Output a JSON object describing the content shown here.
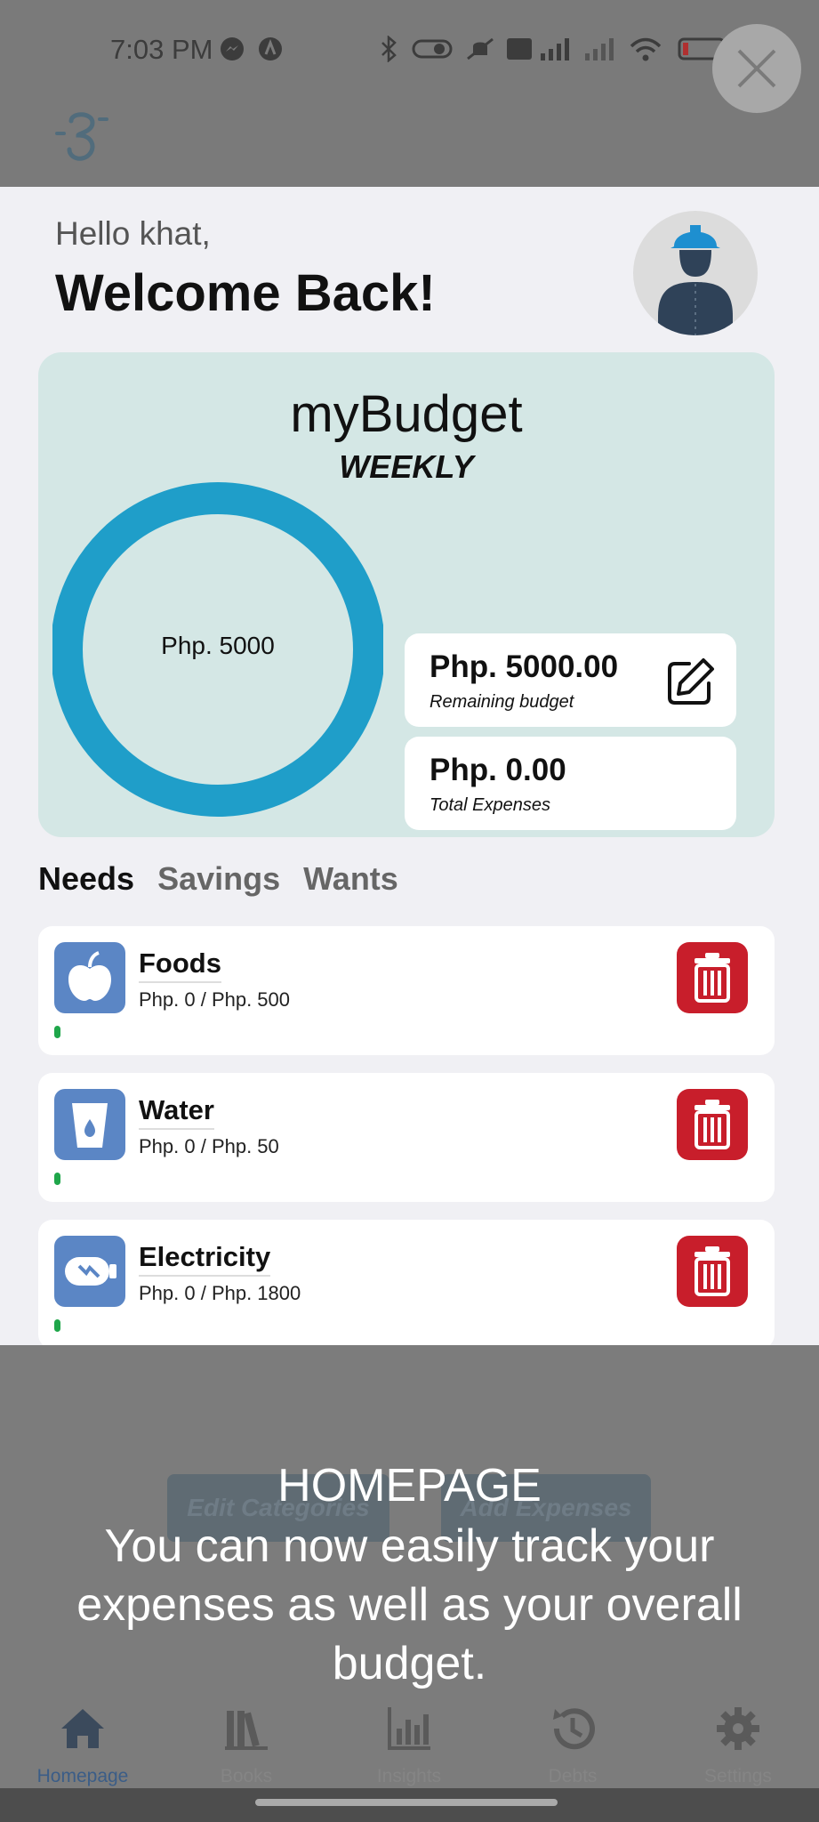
{
  "status_bar": {
    "time": "7:03 PM",
    "battery": "14"
  },
  "greeting": {
    "hello": "Hello khat,",
    "welcome": "Welcome Back!"
  },
  "budget": {
    "title": "myBudget",
    "period": "WEEKLY",
    "donut_label": "Php. 5000",
    "remaining_amount": "Php. 5000.00",
    "remaining_label": "Remaining budget",
    "expenses_amount": "Php. 0.00",
    "expenses_label": "Total Expenses",
    "remaining_fraction": 1.0,
    "ring_color": "#1f9ec9"
  },
  "tabs": [
    {
      "label": "Needs",
      "active": true
    },
    {
      "label": "Savings",
      "active": false
    },
    {
      "label": "Wants",
      "active": false
    }
  ],
  "categories": [
    {
      "name": "Foods",
      "amount": "Php. 0 / Php. 500",
      "icon": "apple-icon",
      "progress": 0
    },
    {
      "name": "Water",
      "amount": "Php. 0 / Php. 50",
      "icon": "water-glass-icon",
      "progress": 0
    },
    {
      "name": "Electricity",
      "amount": "Php. 0 / Php. 1800",
      "icon": "electricity-icon",
      "progress": 0
    }
  ],
  "buttons": {
    "edit_categories": "Edit Categories",
    "add_expenses": "Add Expenses"
  },
  "tooltip": {
    "title": "HOMEPAGE",
    "body": "You can now easily track your expenses as well as your overall budget."
  },
  "nav": [
    {
      "label": "Homepage",
      "icon": "home-icon",
      "active": true
    },
    {
      "label": "Books",
      "icon": "books-icon",
      "active": false
    },
    {
      "label": "Insights",
      "icon": "bar-chart-icon",
      "active": false
    },
    {
      "label": "Debts",
      "icon": "history-icon",
      "active": false
    },
    {
      "label": "Settings",
      "icon": "gear-icon",
      "active": false
    }
  ],
  "colors": {
    "accent": "#1f9ec9",
    "danger": "#c81e2b",
    "category_icon_bg": "#5b86c5",
    "card_bg": "#d4e7e5"
  }
}
